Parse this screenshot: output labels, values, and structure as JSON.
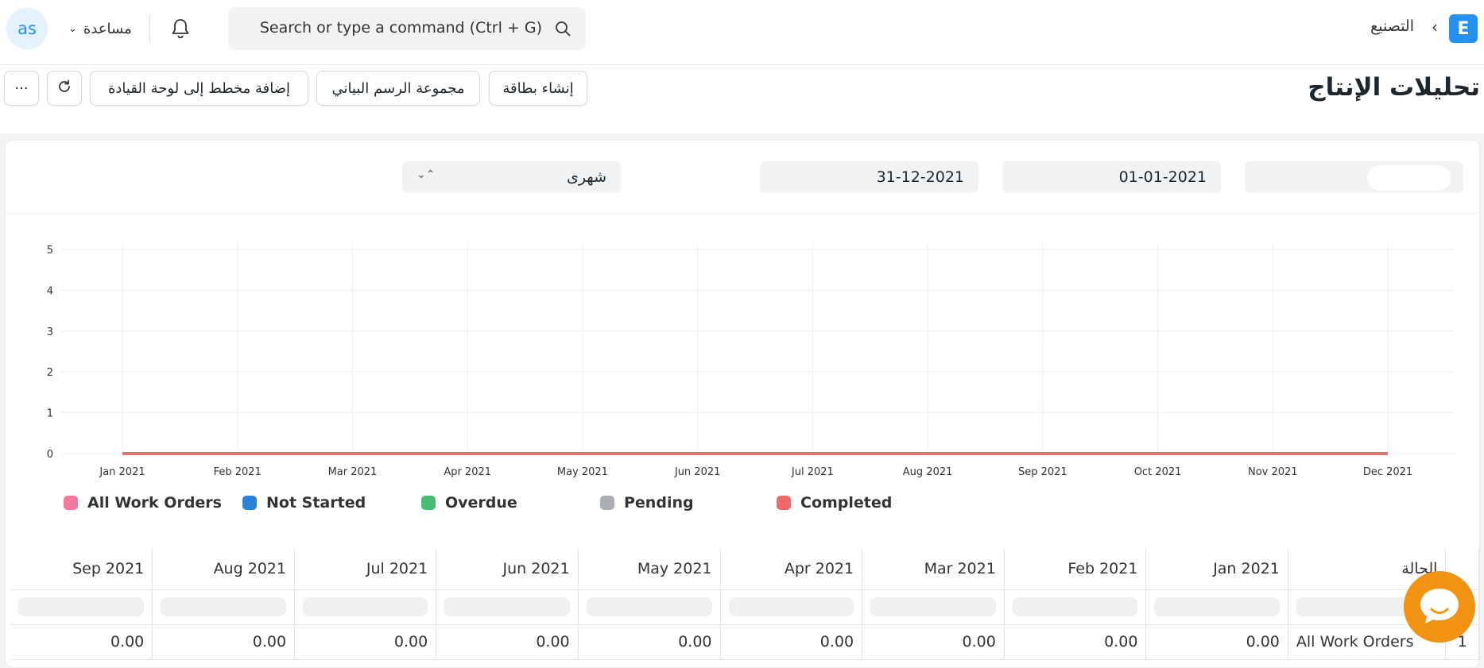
{
  "navbar": {
    "avatar_initials": "as",
    "help_label": "مساعدة",
    "search_placeholder": "Search or type a command (Ctrl + G)",
    "breadcrumb": "التصنيع",
    "logo_letter": "E"
  },
  "page": {
    "title": "تحليلات الإنتاج",
    "buttons": {
      "create_card": "إنشاء بطاقة",
      "chart_group": "مجموعة الرسم البياني",
      "add_to_dashboard": "إضافة مخطط إلى لوحة القيادة",
      "more": "···"
    }
  },
  "filters": {
    "from_date": "01-01-2021",
    "to_date": "31-12-2021",
    "range": "شهرى"
  },
  "colors": {
    "primary": "#2490ef",
    "chat": "#f39313"
  },
  "chart_data": {
    "type": "line",
    "x": [
      "Jan 2021",
      "Feb 2021",
      "Mar 2021",
      "Apr 2021",
      "May 2021",
      "Jun 2021",
      "Jul 2021",
      "Aug 2021",
      "Sep 2021",
      "Oct 2021",
      "Nov 2021",
      "Dec 2021"
    ],
    "y_ticks": [
      "0",
      "1",
      "2",
      "3",
      "4",
      "5"
    ],
    "ylim": [
      0,
      5
    ],
    "grid": true,
    "legend_position": "bottom-left",
    "series": [
      {
        "name": "All Work Orders",
        "color": "#f27a9d",
        "values": [
          0,
          0,
          0,
          0,
          0,
          0,
          0,
          0,
          0,
          0,
          0,
          0
        ]
      },
      {
        "name": "Not Started",
        "color": "#2b82d9",
        "values": [
          0,
          0,
          0,
          0,
          0,
          0,
          0,
          0,
          0,
          0,
          0,
          0
        ]
      },
      {
        "name": "Overdue",
        "color": "#48bb74",
        "values": [
          0,
          0,
          0,
          0,
          0,
          0,
          0,
          0,
          0,
          0,
          0,
          0
        ]
      },
      {
        "name": "Pending",
        "color": "#a9afb5",
        "values": [
          0,
          0,
          0,
          0,
          0,
          0,
          0,
          0,
          0,
          0,
          0,
          0
        ]
      },
      {
        "name": "Completed",
        "color": "#ee6a6a",
        "values": [
          0,
          0,
          0,
          0,
          0,
          0,
          0,
          0,
          0,
          0,
          0,
          0
        ]
      }
    ]
  },
  "table": {
    "columns": [
      "الحالة",
      "Jan 2021",
      "Feb 2021",
      "Mar 2021",
      "Apr 2021",
      "May 2021",
      "Jun 2021",
      "Jul 2021",
      "Aug 2021",
      "Sep 2021"
    ],
    "rows": [
      {
        "index": "1",
        "cells": [
          "All Work Orders",
          "0.00",
          "0.00",
          "0.00",
          "0.00",
          "0.00",
          "0.00",
          "0.00",
          "0.00",
          "0.00"
        ]
      }
    ]
  }
}
